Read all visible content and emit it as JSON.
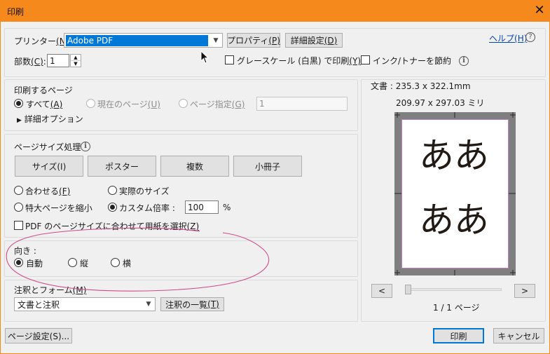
{
  "window": {
    "title": "印刷",
    "close": "✕"
  },
  "printer": {
    "label": "プリンター",
    "label_key": "(N)",
    "selected": "Adobe PDF",
    "properties_label": "プロパティ",
    "properties_key": "(P)",
    "advanced_label": "詳細設定",
    "advanced_key": "(D)",
    "help_label": "ヘルプ",
    "help_key": "(H)",
    "copies_label": "部数",
    "copies_key": "(C)",
    "copies_value": "1",
    "grayscale_label": "グレースケール (白黒) で印刷",
    "grayscale_key": "(Y)",
    "grayscale_checked": false,
    "save_ink_label": "インク/トナーを節約",
    "save_ink_checked": false
  },
  "pages": {
    "heading": "印刷するページ",
    "all_label": "すべて",
    "all_key": "(A)",
    "current_label": "現在のページ",
    "current_key": "(U)",
    "range_label": "ページ指定",
    "range_key": "(G)",
    "range_value": "1",
    "more_options": "詳細オプション",
    "selected": "all"
  },
  "sizing": {
    "heading": "ページサイズ処理",
    "buttons": [
      "サイズ(I)",
      "ポスター",
      "複数",
      "小冊子"
    ],
    "fit_label": "合わせる",
    "fit_key": "(F)",
    "actual_label": "実際のサイズ",
    "shrink_label": "特大ページを縮小",
    "custom_label": "カスタム倍率 :",
    "custom_value": "100",
    "percent": "%",
    "selected": "custom",
    "pdf_paper_label": "PDF のページサイズに合わせて用紙を選択",
    "pdf_paper_key": "(Z)",
    "pdf_paper_checked": false
  },
  "orientation": {
    "heading": "向き :",
    "auto_label": "自動",
    "portrait_label": "縦",
    "landscape_label": "横",
    "selected": "auto",
    "annotation_color": "#d04a8a"
  },
  "comments": {
    "heading": "注釈とフォーム",
    "heading_key": "(M)",
    "selected": "文書と注釈",
    "summarize_label": "注釈の一覧",
    "summarize_key": "(T)"
  },
  "preview": {
    "doc_label": "文書 :",
    "doc_size": "235.3 x 322.1mm",
    "paper_size": "209.97 x 297.03 ミリ",
    "line1": "ああ",
    "line2": "ああ",
    "prev": "<",
    "next": ">",
    "page_indicator": "1 / 1 ページ",
    "slider_fraction": 0.0
  },
  "footer": {
    "page_setup": "ページ設定(S)...",
    "print": "印刷",
    "cancel": "キャンセル"
  },
  "colors": {
    "titlebar": "#f5891c",
    "accent": "#0078d7",
    "link": "#0645ad"
  }
}
